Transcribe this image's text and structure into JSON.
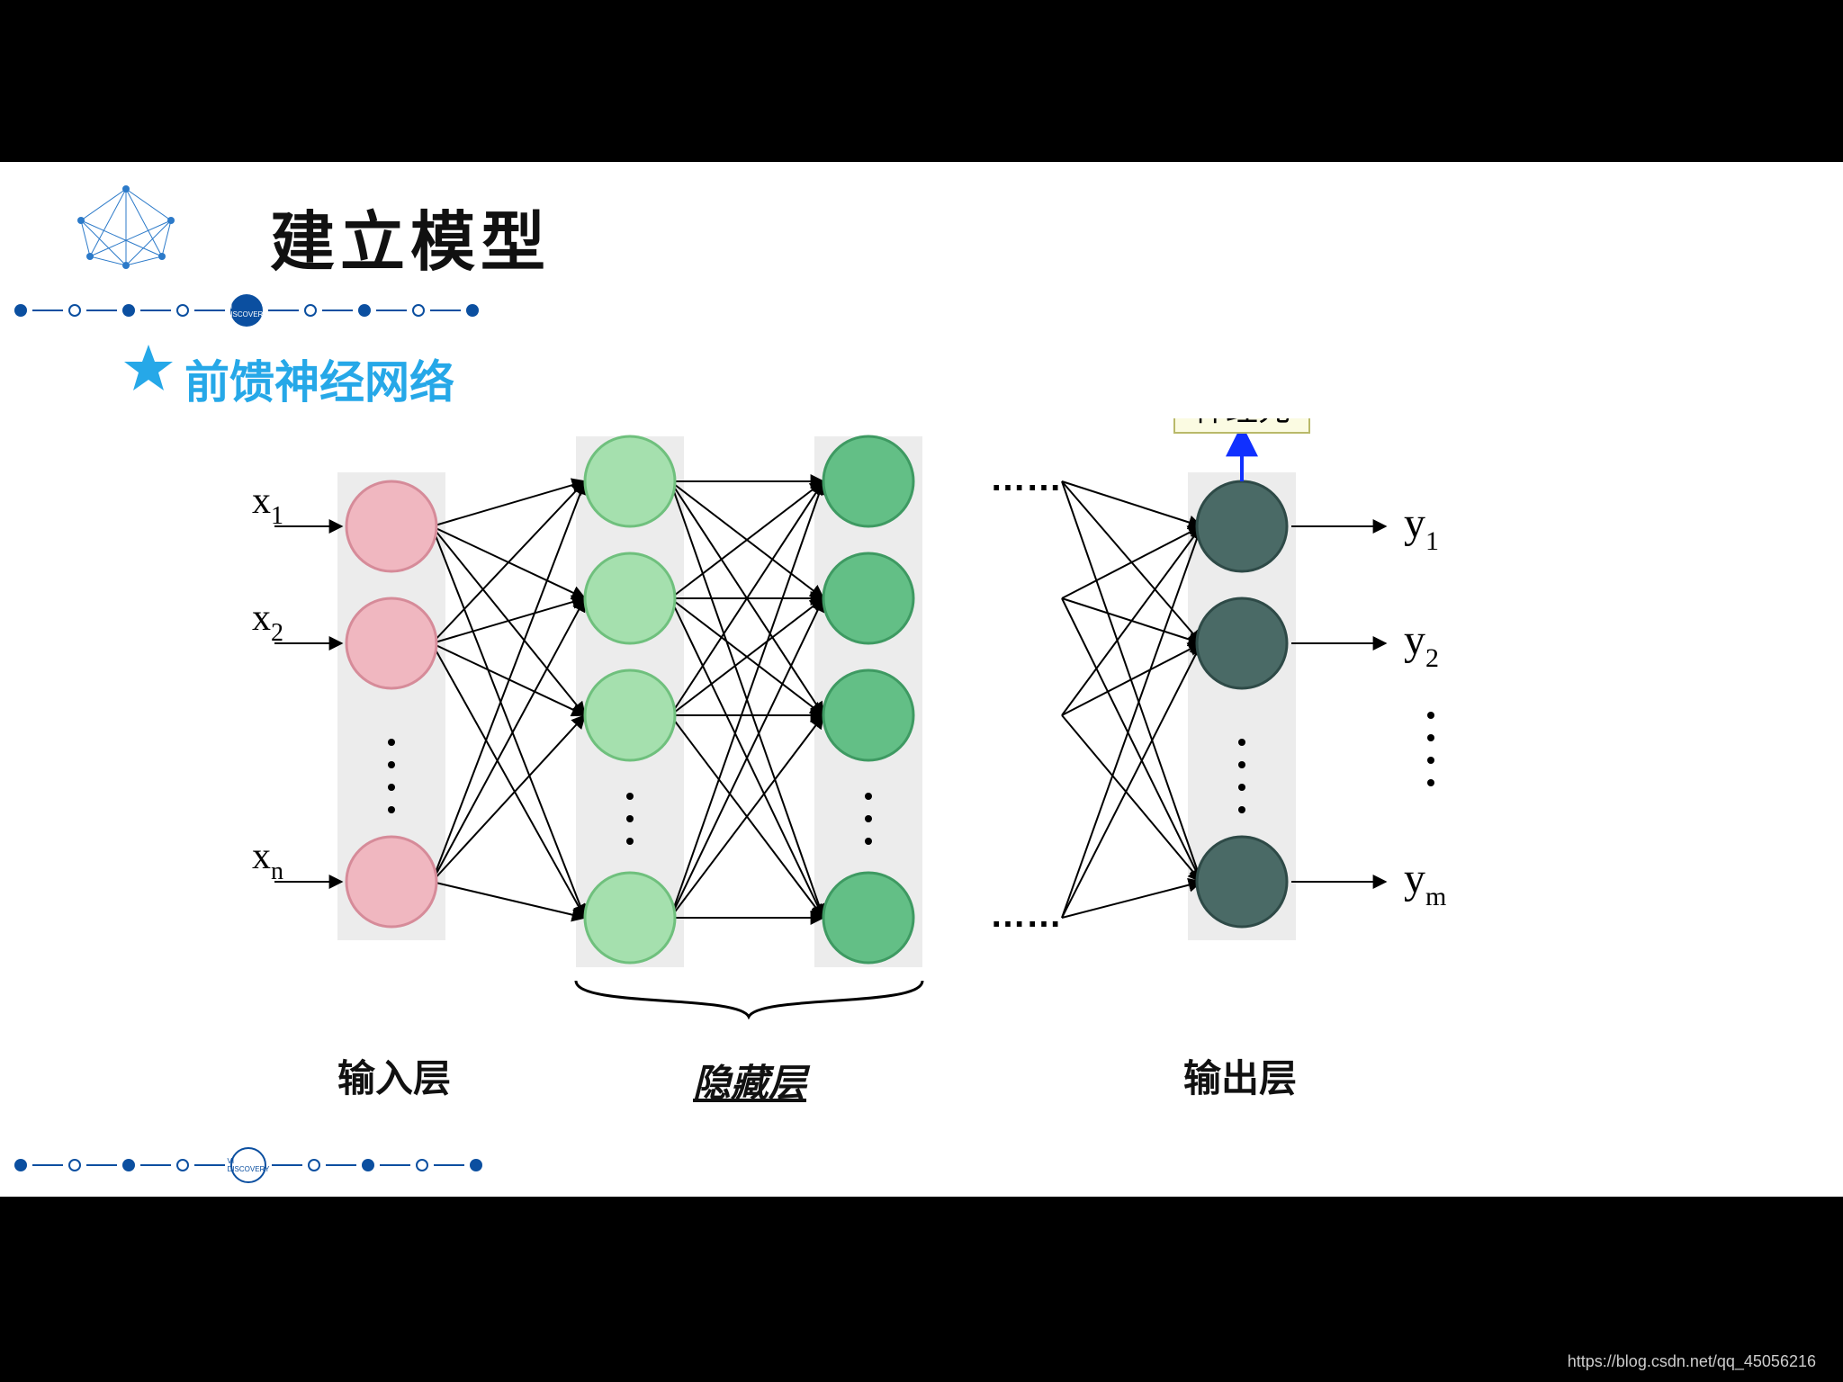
{
  "title": "建立模型",
  "subtitle": "前馈神经网络",
  "badge": "AI DISCOVERY",
  "badge2": "VI DISCOVERY",
  "callout": "神经元",
  "inputs": {
    "x1": "x",
    "x1s": "1",
    "x2": "x",
    "x2s": "2",
    "xn": "x",
    "xns": "n"
  },
  "outputs": {
    "y1": "y",
    "y1s": "1",
    "y2": "y",
    "y2s": "2",
    "ym": "y",
    "yms": "m"
  },
  "layers": {
    "input": "输入层",
    "hidden": "隐藏层",
    "output": "输出层"
  },
  "dots": "……",
  "vdots": "⋮",
  "watermark": "https://blog.csdn.net/qq_45056216",
  "colors": {
    "inputNode": "#f0b7c0",
    "inputStroke": "#d68b99",
    "hidden1": "#a5e0ae",
    "hidden1Stroke": "#6fc07d",
    "hidden2": "#63bf86",
    "hidden2Stroke": "#3e9a62",
    "outputNode": "#4a6a66",
    "outputStroke": "#2e4a47",
    "box": "#ececec"
  }
}
